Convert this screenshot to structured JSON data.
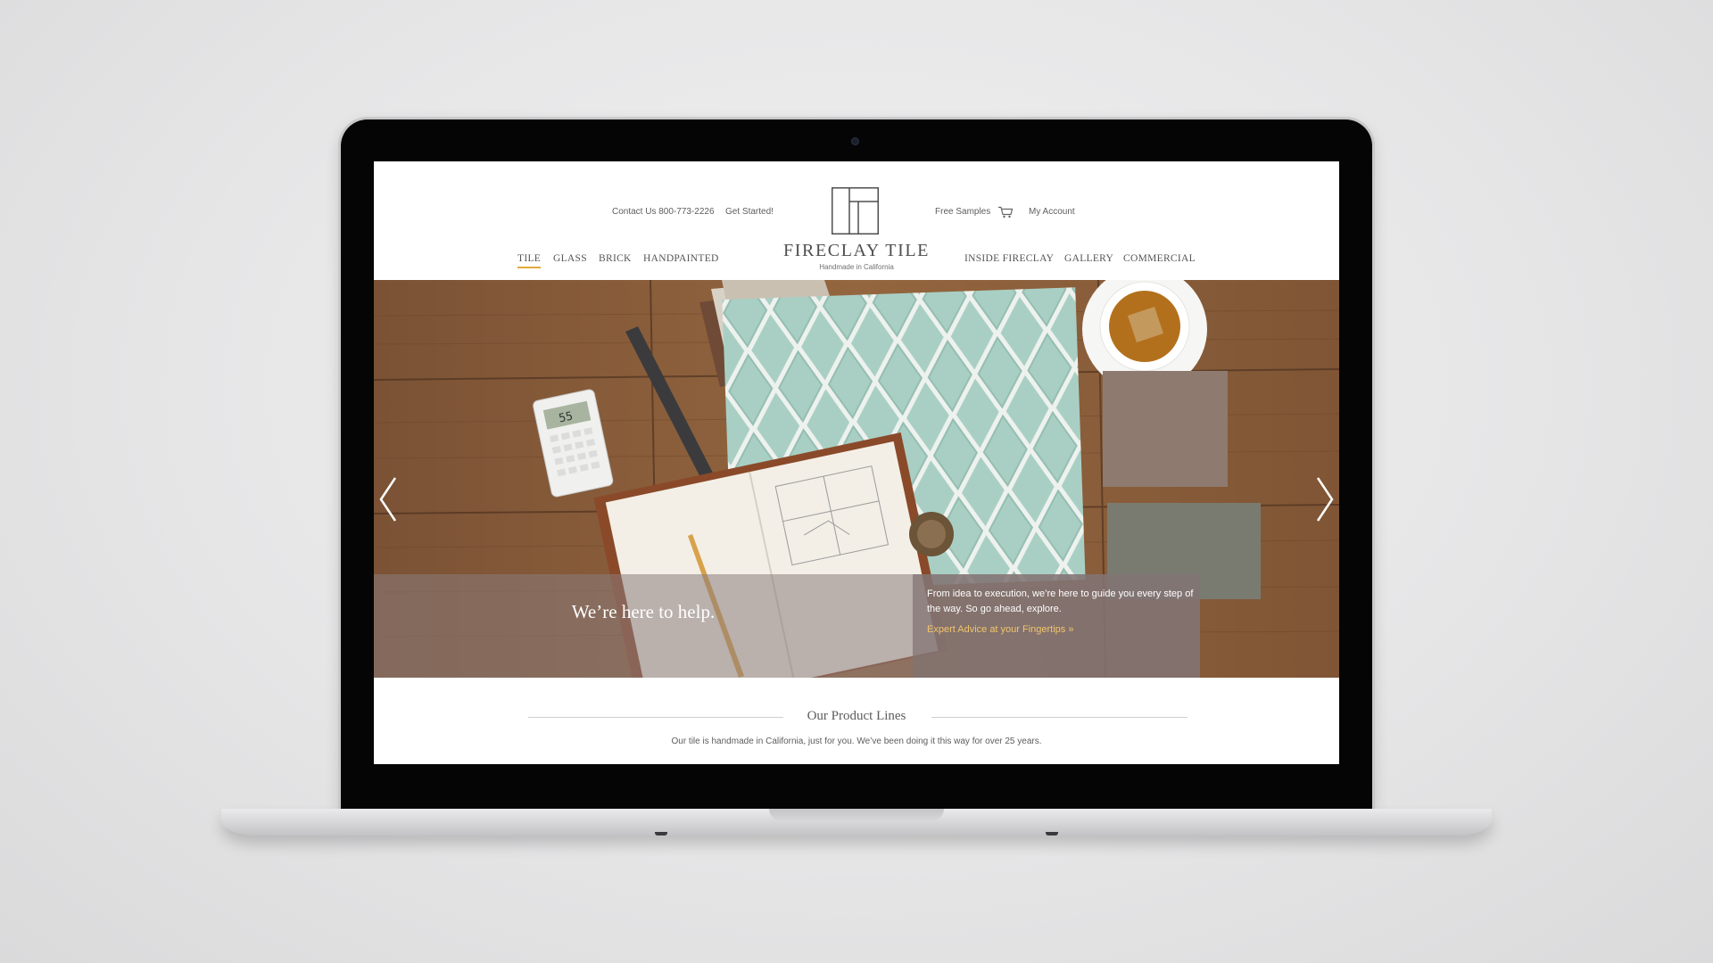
{
  "header": {
    "contact": "Contact Us 800-773-2226",
    "get_started": "Get Started!",
    "free_samples": "Free Samples",
    "my_account": "My Account",
    "cart_icon": "shopping-cart-icon"
  },
  "logo": {
    "name": "FIRECLAY TILE",
    "tagline": "Handmade in California"
  },
  "nav_left": [
    {
      "label": "TILE",
      "active": true
    },
    {
      "label": "GLASS",
      "active": false
    },
    {
      "label": "BRICK",
      "active": false
    },
    {
      "label": "HANDPAINTED",
      "active": false
    }
  ],
  "nav_right": [
    {
      "label": "INSIDE FIRECLAY"
    },
    {
      "label": "GALLERY"
    },
    {
      "label": "COMMERCIAL"
    }
  ],
  "hero": {
    "headline": "We’re here to help.",
    "body": "From idea to execution, we’re here to guide you every step of the way. So go ahead, explore.",
    "link": "Expert Advice at your Fingertips »",
    "prev_icon": "chevron-left-icon",
    "next_icon": "chevron-right-icon",
    "calculator_display": "55"
  },
  "product_lines": {
    "title": "Our Product Lines",
    "subtitle": "Our tile is handmade in California, just for you. We’ve been doing it this way for over 25 years."
  },
  "colors": {
    "accent_underline": "#e2a93b",
    "link_gold": "#f2c56b",
    "banner_overlay": "#827474",
    "tile_glaze": "#a9cfc4",
    "wood": "#8a5f3d"
  }
}
